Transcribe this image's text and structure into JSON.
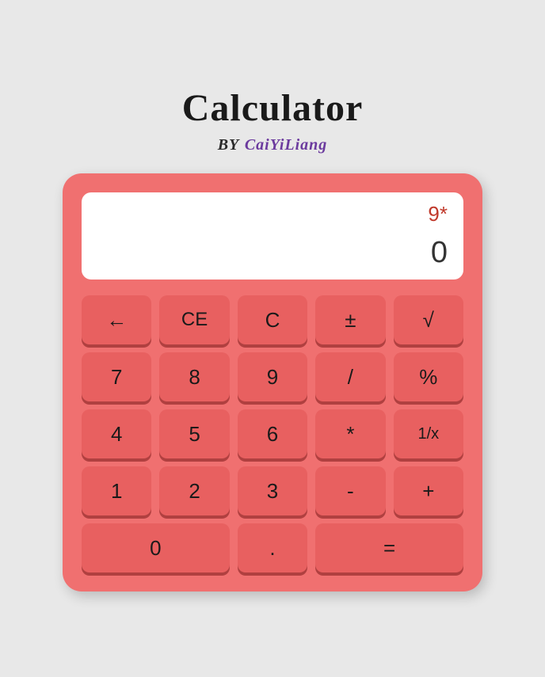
{
  "page": {
    "title": "Calculator",
    "subtitle_by": "BY",
    "subtitle_author": "CaiYiLiang"
  },
  "display": {
    "expression": "9*",
    "result": "0"
  },
  "buttons": {
    "row1": [
      {
        "label": "←",
        "name": "backspace-button"
      },
      {
        "label": "CE",
        "name": "ce-button"
      },
      {
        "label": "C",
        "name": "clear-button"
      },
      {
        "label": "±",
        "name": "plusminus-button"
      },
      {
        "label": "√",
        "name": "sqrt-button"
      }
    ],
    "row2": [
      {
        "label": "7",
        "name": "seven-button"
      },
      {
        "label": "8",
        "name": "eight-button"
      },
      {
        "label": "9",
        "name": "nine-button"
      },
      {
        "label": "/",
        "name": "divide-button"
      },
      {
        "label": "%",
        "name": "percent-button"
      }
    ],
    "row3": [
      {
        "label": "4",
        "name": "four-button"
      },
      {
        "label": "5",
        "name": "five-button"
      },
      {
        "label": "6",
        "name": "six-button"
      },
      {
        "label": "*",
        "name": "multiply-button"
      },
      {
        "label": "1/x",
        "name": "reciprocal-button"
      }
    ],
    "row4": [
      {
        "label": "1",
        "name": "one-button"
      },
      {
        "label": "2",
        "name": "two-button"
      },
      {
        "label": "3",
        "name": "three-button"
      },
      {
        "label": "-",
        "name": "subtract-button"
      },
      {
        "label": "+",
        "name": "add-button"
      }
    ],
    "row5": [
      {
        "label": "0",
        "name": "zero-button",
        "span": 2
      },
      {
        "label": ".",
        "name": "decimal-button"
      },
      {
        "label": "=",
        "name": "equals-button",
        "span": 2
      }
    ]
  }
}
